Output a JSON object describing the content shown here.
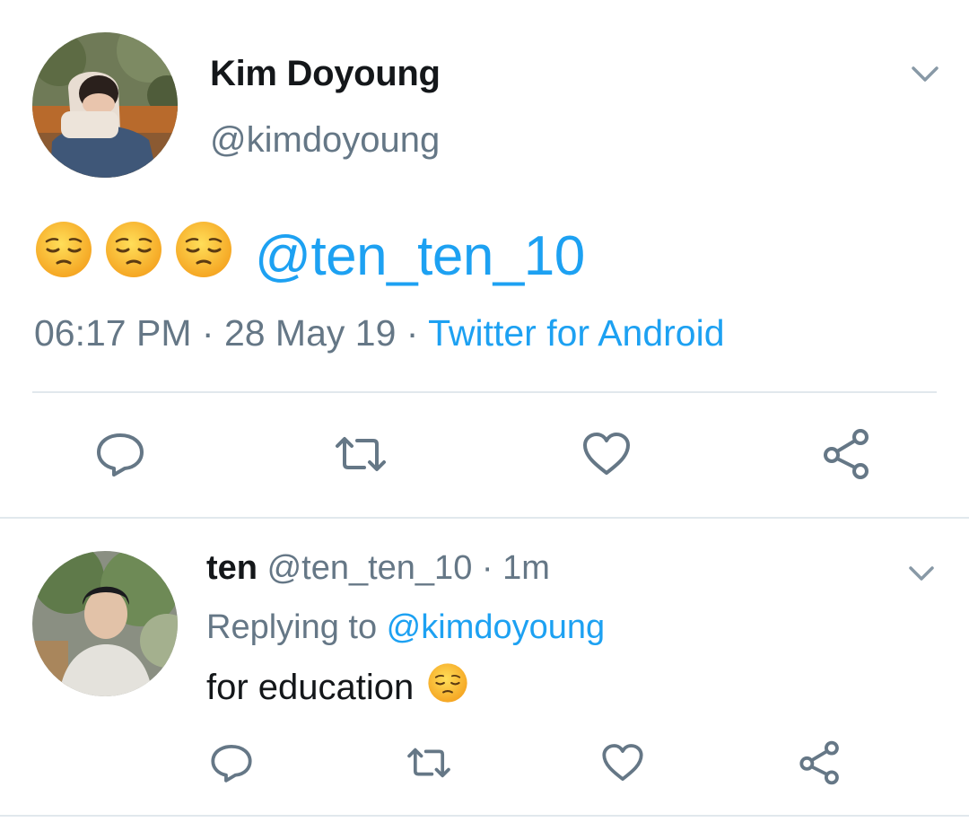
{
  "main_tweet": {
    "display_name": "Kim Doyoung",
    "handle": "@kimdoyoung",
    "mention": "@ten_ten_10",
    "time": "06:17 PM",
    "sep1": " · ",
    "date": "28 May 19",
    "sep2": " · ",
    "source": "Twitter for Android",
    "emoji_count": 3
  },
  "reply_tweet": {
    "display_name": "ten",
    "handle": "@ten_ten_10",
    "sep": " · ",
    "age": "1m",
    "replying_label": "Replying to ",
    "replying_to": "@kimdoyoung",
    "text": "for education "
  },
  "icons": {
    "caret": "chevron-down-icon",
    "reply": "reply-icon",
    "retweet": "retweet-icon",
    "like": "heart-icon",
    "share": "share-icon",
    "emoji": "pensive-face-emoji"
  },
  "colors": {
    "link": "#1da1f2",
    "secondary_text": "#657786",
    "icon": "#657786",
    "divider": "#e1e8ed"
  }
}
